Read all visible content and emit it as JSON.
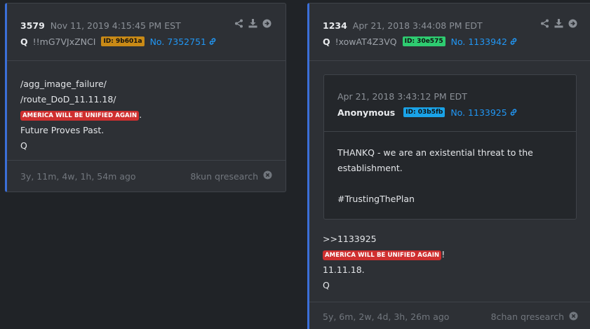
{
  "posts": [
    {
      "number": "3579",
      "date": "Nov 11, 2019 4:15:45 PM EST",
      "name": "Q",
      "trip": "!!mG7VJxZNCI",
      "id_badge": "ID: 9b601a",
      "id_color": "#c98a16",
      "post_no": "No. 7352751",
      "lines": [
        "/agg_image_failure/",
        "/route_DoD_11.11.18/"
      ],
      "flag_text": "AMERICA WILL BE UNIFIED AGAIN",
      "flag_suffix": ".",
      "tail_lines": [
        "Future Proves Past.",
        "Q"
      ],
      "age": "3y, 11m, 4w, 1h, 54m ago",
      "source": "8kun qresearch"
    },
    {
      "number": "1234",
      "date": "Apr 21, 2018 3:44:08 PM EDT",
      "name": "Q",
      "trip": "!xowAT4Z3VQ",
      "id_badge": "ID: 30e575",
      "id_color": "#2ecc71",
      "post_no": "No. 1133942",
      "quote": {
        "date": "Apr 21, 2018 3:43:12 PM EDT",
        "name": "Anonymous",
        "id_badge": "ID: 03b5fb",
        "id_color": "#1aa3e8",
        "post_no": "No. 1133925",
        "line1": "THANKQ - we are an existential threat to the",
        "line2": "establishment.",
        "line3": "#TrustingThePlan"
      },
      "lines": [
        ">>1133925"
      ],
      "flag_text": "AMERICA WILL BE UNIFIED AGAIN",
      "flag_suffix": "!",
      "tail_lines": [
        "11.11.18.",
        "Q"
      ],
      "age": "5y, 6m, 2w, 4d, 3h, 26m ago",
      "source": "8chan qresearch"
    }
  ],
  "colors": {
    "background": "#202327",
    "card": "#2d3035",
    "accent_border": "#3b6fd8",
    "link": "#2196f3",
    "flag": "#cf2f2f"
  },
  "icons": [
    "share-icon",
    "download-icon",
    "open-icon",
    "link-icon",
    "close-icon"
  ]
}
